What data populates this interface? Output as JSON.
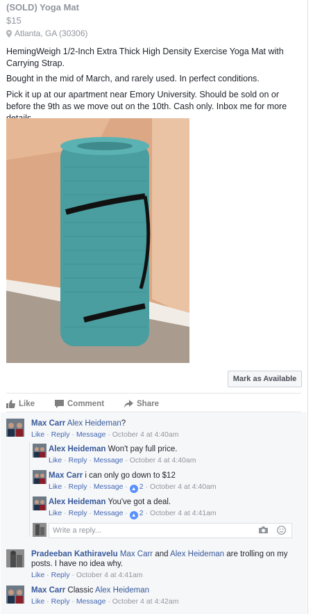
{
  "listing": {
    "title": "(SOLD) Yoga Mat",
    "price": "$15",
    "location": "Atlanta, GA (30306)",
    "description": [
      "HemingWeigh 1/2-Inch Extra Thick High Density Exercise Yoga Mat with Carrying Strap.",
      "Bought in the mid of March, and rarely used. In perfect conditions.",
      "Pick it up at our apartment near Emory University. Should be sold on or before the 9th as we move out on the 10th. Cash only. Inbox me for more details."
    ],
    "mark_button": "Mark as Available"
  },
  "actions": {
    "like": "Like",
    "comment": "Comment",
    "share": "Share"
  },
  "comments": [
    {
      "author": "Max Carr",
      "mention": "Alex Heideman",
      "text": "?",
      "like": "Like",
      "reply": "Reply",
      "message": "Message",
      "time": "October 4 at 4:40am"
    },
    {
      "author": "Alex Heideman",
      "text": "Won't pay full price.",
      "like": "Like",
      "reply": "Reply",
      "message": "Message",
      "time": "October 4 at 4:40am"
    },
    {
      "author": "Max Carr",
      "text": "i can only go down to $12",
      "like": "Like",
      "reply": "Reply",
      "message": "Message",
      "likes": "2",
      "time": "October 4 at 4:40am"
    },
    {
      "author": "Alex Heideman",
      "text": "You've got a deal.",
      "like": "Like",
      "reply": "Reply",
      "message": "Message",
      "likes": "2",
      "time": "October 4 at 4:41am"
    },
    {
      "author": "Pradeeban Kathiravelu",
      "mention1": "Max Carr",
      "and": "and",
      "mention2": "Alex Heideman",
      "text": "are trolling on my posts. I have no idea why.",
      "like": "Like",
      "reply": "Reply",
      "time": "October 4 at 4:41am"
    },
    {
      "author": "Max Carr",
      "text": "Classic",
      "mention": "Alex Heideman",
      "like": "Like",
      "reply": "Reply",
      "message": "Message",
      "time": "October 4 at 4:42am"
    }
  ],
  "reply_placeholder": "Write a reply...",
  "colors": {
    "link": "#365899",
    "meta": "#90949c",
    "mat": "#4a9ea0",
    "wall": "#dca784",
    "floor": "#a99c8f"
  }
}
